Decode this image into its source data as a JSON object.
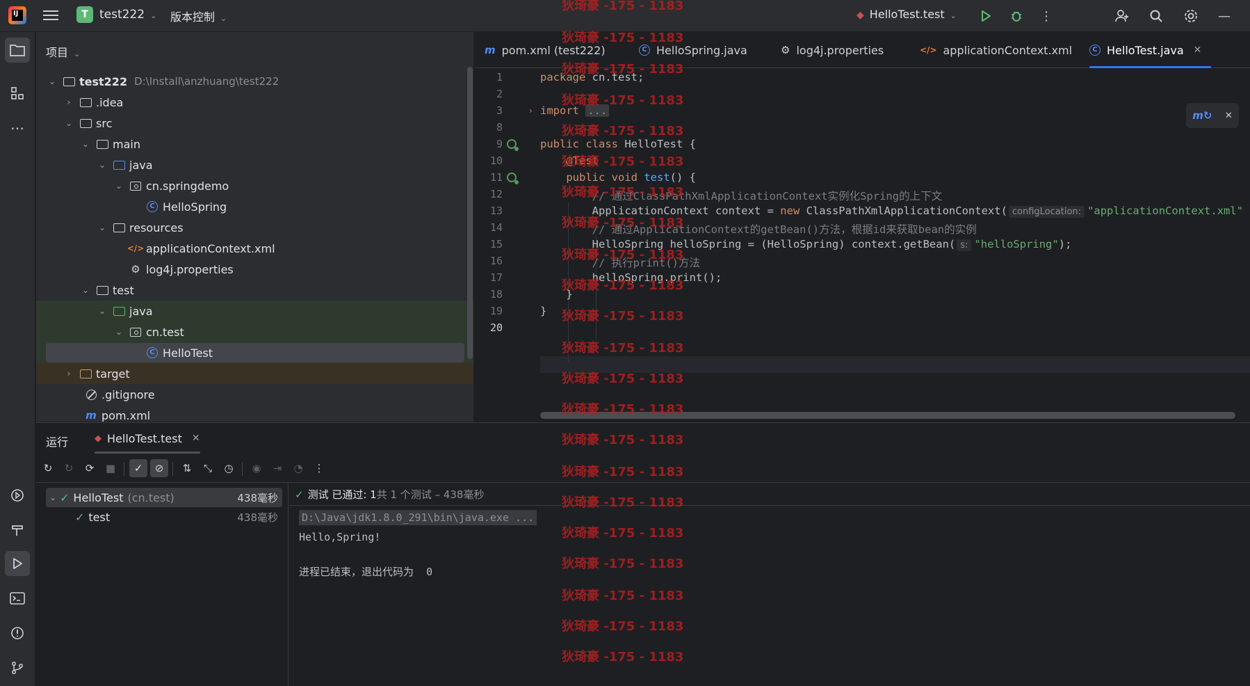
{
  "titlebar": {
    "project_initial": "T",
    "project_name": "test222",
    "vcs_label": "版本控制",
    "run_config": "HelloTest.test"
  },
  "project_panel": {
    "title": "项目",
    "tree": [
      {
        "label": "test222",
        "path": "D:\\Install\\anzhuang\\test222",
        "icon": "module-folder-icon"
      },
      {
        "label": ".idea",
        "icon": "folder-icon"
      },
      {
        "label": "src",
        "icon": "folder-icon"
      },
      {
        "label": "main",
        "icon": "folder-icon"
      },
      {
        "label": "java",
        "icon": "source-folder-icon"
      },
      {
        "label": "cn.springdemo",
        "icon": "package-icon"
      },
      {
        "label": "HelloSpring",
        "icon": "class-icon"
      },
      {
        "label": "resources",
        "icon": "resources-folder-icon"
      },
      {
        "label": "applicationContext.xml",
        "icon": "xml-file-icon"
      },
      {
        "label": "log4j.properties",
        "icon": "properties-file-icon"
      },
      {
        "label": "test",
        "icon": "folder-icon"
      },
      {
        "label": "java",
        "icon": "test-folder-icon"
      },
      {
        "label": "cn.test",
        "icon": "package-icon"
      },
      {
        "label": "HelloTest",
        "icon": "class-icon"
      },
      {
        "label": "target",
        "icon": "excluded-folder-icon"
      },
      {
        "label": ".gitignore",
        "icon": "ignored-file-icon"
      },
      {
        "label": "pom.xml",
        "icon": "maven-icon"
      }
    ]
  },
  "editor": {
    "tabs": [
      {
        "label": "pom.xml (test222)",
        "icon": "maven-icon"
      },
      {
        "label": "HelloSpring.java",
        "icon": "class-icon"
      },
      {
        "label": "log4j.properties",
        "icon": "properties-file-icon"
      },
      {
        "label": "applicationContext.xml",
        "icon": "xml-file-icon"
      },
      {
        "label": "HelloTest.java",
        "icon": "class-icon",
        "active": true
      }
    ],
    "line_numbers": [
      "1",
      "2",
      "3",
      "8",
      "9",
      "10",
      "11",
      "12",
      "13",
      "14",
      "15",
      "16",
      "17",
      "18",
      "19",
      "20"
    ],
    "code": {
      "l1_kw": "package",
      "l1_rest": " cn.test;",
      "l3_kw": "import",
      "l3_fold": "...",
      "l9_kw": "public class",
      "l9_rest": " HelloTest {",
      "l10_ann": "@Test",
      "l11_kw": "public void",
      "l11_fn": "test",
      "l11_rest": "() {",
      "l12_cmt": "// 通过ClassPathXmlApplicationContext实例化Spring的上下文",
      "l13_a": "ApplicationContext context = ",
      "l13_kw": "new",
      "l13_b": " ClassPathXmlApplicationContext(",
      "l13_hint": "configLocation:",
      "l13_str": "\"applicationContext.xml\"",
      "l14_cmt": "// 通过ApplicationContext的getBean()方法，根据id来获取bean的实例",
      "l15_a": "HelloSpring helloSpring = (HelloSpring) context.getBean(",
      "l15_hint": "s:",
      "l15_str": "\"helloSpring\"",
      "l15_b": ");",
      "l16_cmt": "// 执行print()方法",
      "l17": "helloSpring.print();",
      "l18": "}",
      "l19": "}"
    }
  },
  "run_panel": {
    "title": "运行",
    "tab_label": "HelloTest.test",
    "tests": [
      {
        "name": "HelloTest",
        "pkg": "(cn.test)",
        "time": "438毫秒"
      },
      {
        "name": "test",
        "time": "438毫秒"
      }
    ],
    "status_pass": "测试 已通过: 1",
    "status_total": "共 1 个测试 – 438毫秒",
    "console": {
      "cmd": "D:\\Java\\jdk1.8.0_291\\bin\\java.exe ...",
      "output": "Hello,Spring!",
      "exit": "进程已结束，退出代码为  0"
    }
  },
  "watermark": "狄琦豪 -175 - 1183",
  "colors": {
    "accent": "#3574f0",
    "success": "#5fb878",
    "keyword": "#cf8e6d",
    "string": "#6aab73",
    "function": "#56a8f5",
    "annotation": "#b3ae60",
    "watermark": "#b32020"
  }
}
